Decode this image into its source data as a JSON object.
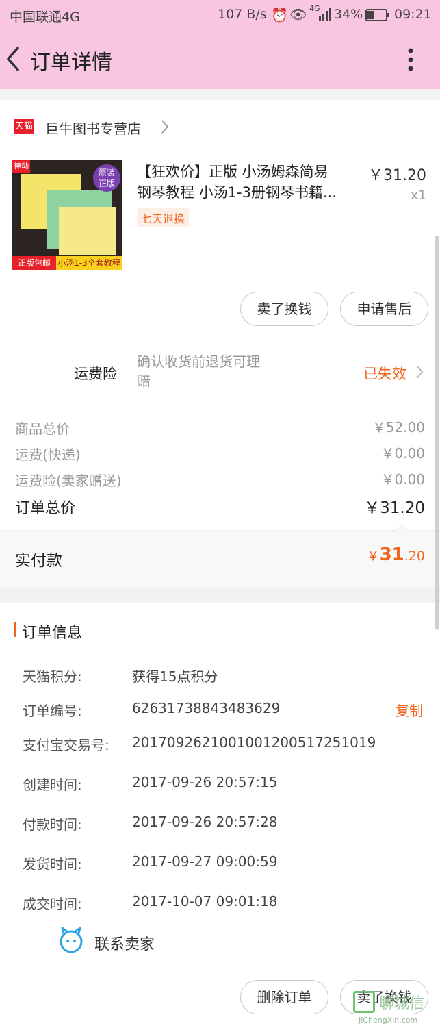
{
  "status": {
    "carrier": "中国联通4G",
    "speed": "107 B/s",
    "signal": "4G",
    "battery": "34%",
    "time": "09:21"
  },
  "header": {
    "title": "订单详情"
  },
  "shop": {
    "badge": "天猫",
    "name": "巨牛图书专营店"
  },
  "product": {
    "title_line1": "【狂欢价】正版 小汤姆森简易",
    "title_line2": "钢琴教程 小汤1-3册钢琴书籍...",
    "tag": "七天退换",
    "price": "￥31.20",
    "qty": "x1",
    "image": {
      "brand": "律动",
      "seal_line1": "原装",
      "seal_line2": "正版",
      "band_left": "正版包邮",
      "band_right": "小汤1-3全套教程"
    }
  },
  "item_actions": {
    "sell": "卖了换钱",
    "after_sale": "申请售后"
  },
  "insurance": {
    "label": "运费险",
    "desc_line1": "确认收货前退货可理",
    "desc_line2": "赔",
    "status": "已失效"
  },
  "summary": {
    "goods_label": "商品总价",
    "goods_value": "￥52.00",
    "shipping_label": "运费(快递)",
    "shipping_value": "￥0.00",
    "ins_label": "运费险(卖家赠送)",
    "ins_value": "￥0.00",
    "total_label": "订单总价",
    "total_value": "￥31.20",
    "paid_label": "实付款",
    "paid_symbol": "￥",
    "paid_int": "31",
    "paid_dec": ".20"
  },
  "order_info": {
    "title": "订单信息",
    "points_label": "天猫积分:",
    "points_value": "获得15点积分",
    "no_label": "订单编号:",
    "no_value": "62631738843483629",
    "copy": "复制",
    "alipay_label": "支付宝交易号:",
    "alipay_value": "2017092621001001200517251019",
    "created_label": "创建时间:",
    "created_value": "2017-09-26 20:57:15",
    "paid_label": "付款时间:",
    "paid_value": "2017-09-26 20:57:28",
    "shipped_label": "发货时间:",
    "shipped_value": "2017-09-27 09:00:59",
    "done_label": "成交时间:",
    "done_value": "2017-10-07 09:01:18"
  },
  "contact": {
    "label": "联系卖家"
  },
  "bottom": {
    "delete": "删除订单",
    "sell": "卖了换钱"
  },
  "watermark": {
    "brand": "聊城信",
    "url": "JiChengXin.com"
  },
  "colors": {
    "header_bg": "#f9c6e1",
    "accent_orange": "#f0641c",
    "tmall_red": "#e8202a"
  }
}
